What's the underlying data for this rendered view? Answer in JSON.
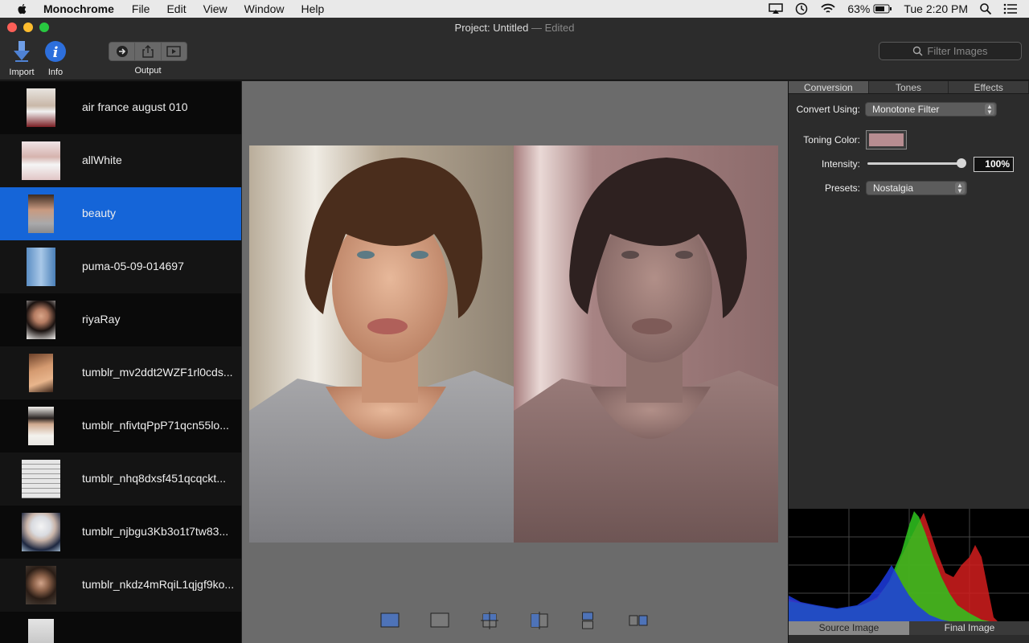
{
  "menubar": {
    "app_name": "Monochrome",
    "items": [
      "File",
      "Edit",
      "View",
      "Window",
      "Help"
    ],
    "battery": "63%",
    "clock": "Tue 2:20 PM"
  },
  "window": {
    "title_label": "Project:",
    "title_name": "Untitled",
    "title_status": "— Edited"
  },
  "toolbar": {
    "import_label": "Import",
    "info_label": "Info",
    "output_label": "Output",
    "filter_placeholder": "Filter Images"
  },
  "images": [
    {
      "name": "air france august 010"
    },
    {
      "name": "allWhite"
    },
    {
      "name": "beauty",
      "selected": true
    },
    {
      "name": "puma-05-09-014697"
    },
    {
      "name": "riyaRay"
    },
    {
      "name": "tumblr_mv2ddt2WZF1rl0cds..."
    },
    {
      "name": "tumblr_nfivtqPpP71qcn55lo..."
    },
    {
      "name": "tumblr_nhq8dxsf451qcqckt..."
    },
    {
      "name": "tumblr_njbgu3Kb3o1t7tw83..."
    },
    {
      "name": "tumblr_nkdz4mRqiL1qjgf9ko..."
    }
  ],
  "panel": {
    "tabs": [
      "Conversion",
      "Tones",
      "Effects"
    ],
    "convert_label": "Convert Using:",
    "convert_value": "Monotone Filter",
    "toning_label": "Toning Color:",
    "toning_color": "#b78d91",
    "intensity_label": "Intensity:",
    "intensity_value": "100%",
    "presets_label": "Presets:",
    "presets_value": "Nostalgia"
  },
  "histogram_tabs": [
    "Source Image",
    "Final Image"
  ],
  "colors": {
    "selection": "#1565d8",
    "accent_info": "#2d6fdc"
  }
}
